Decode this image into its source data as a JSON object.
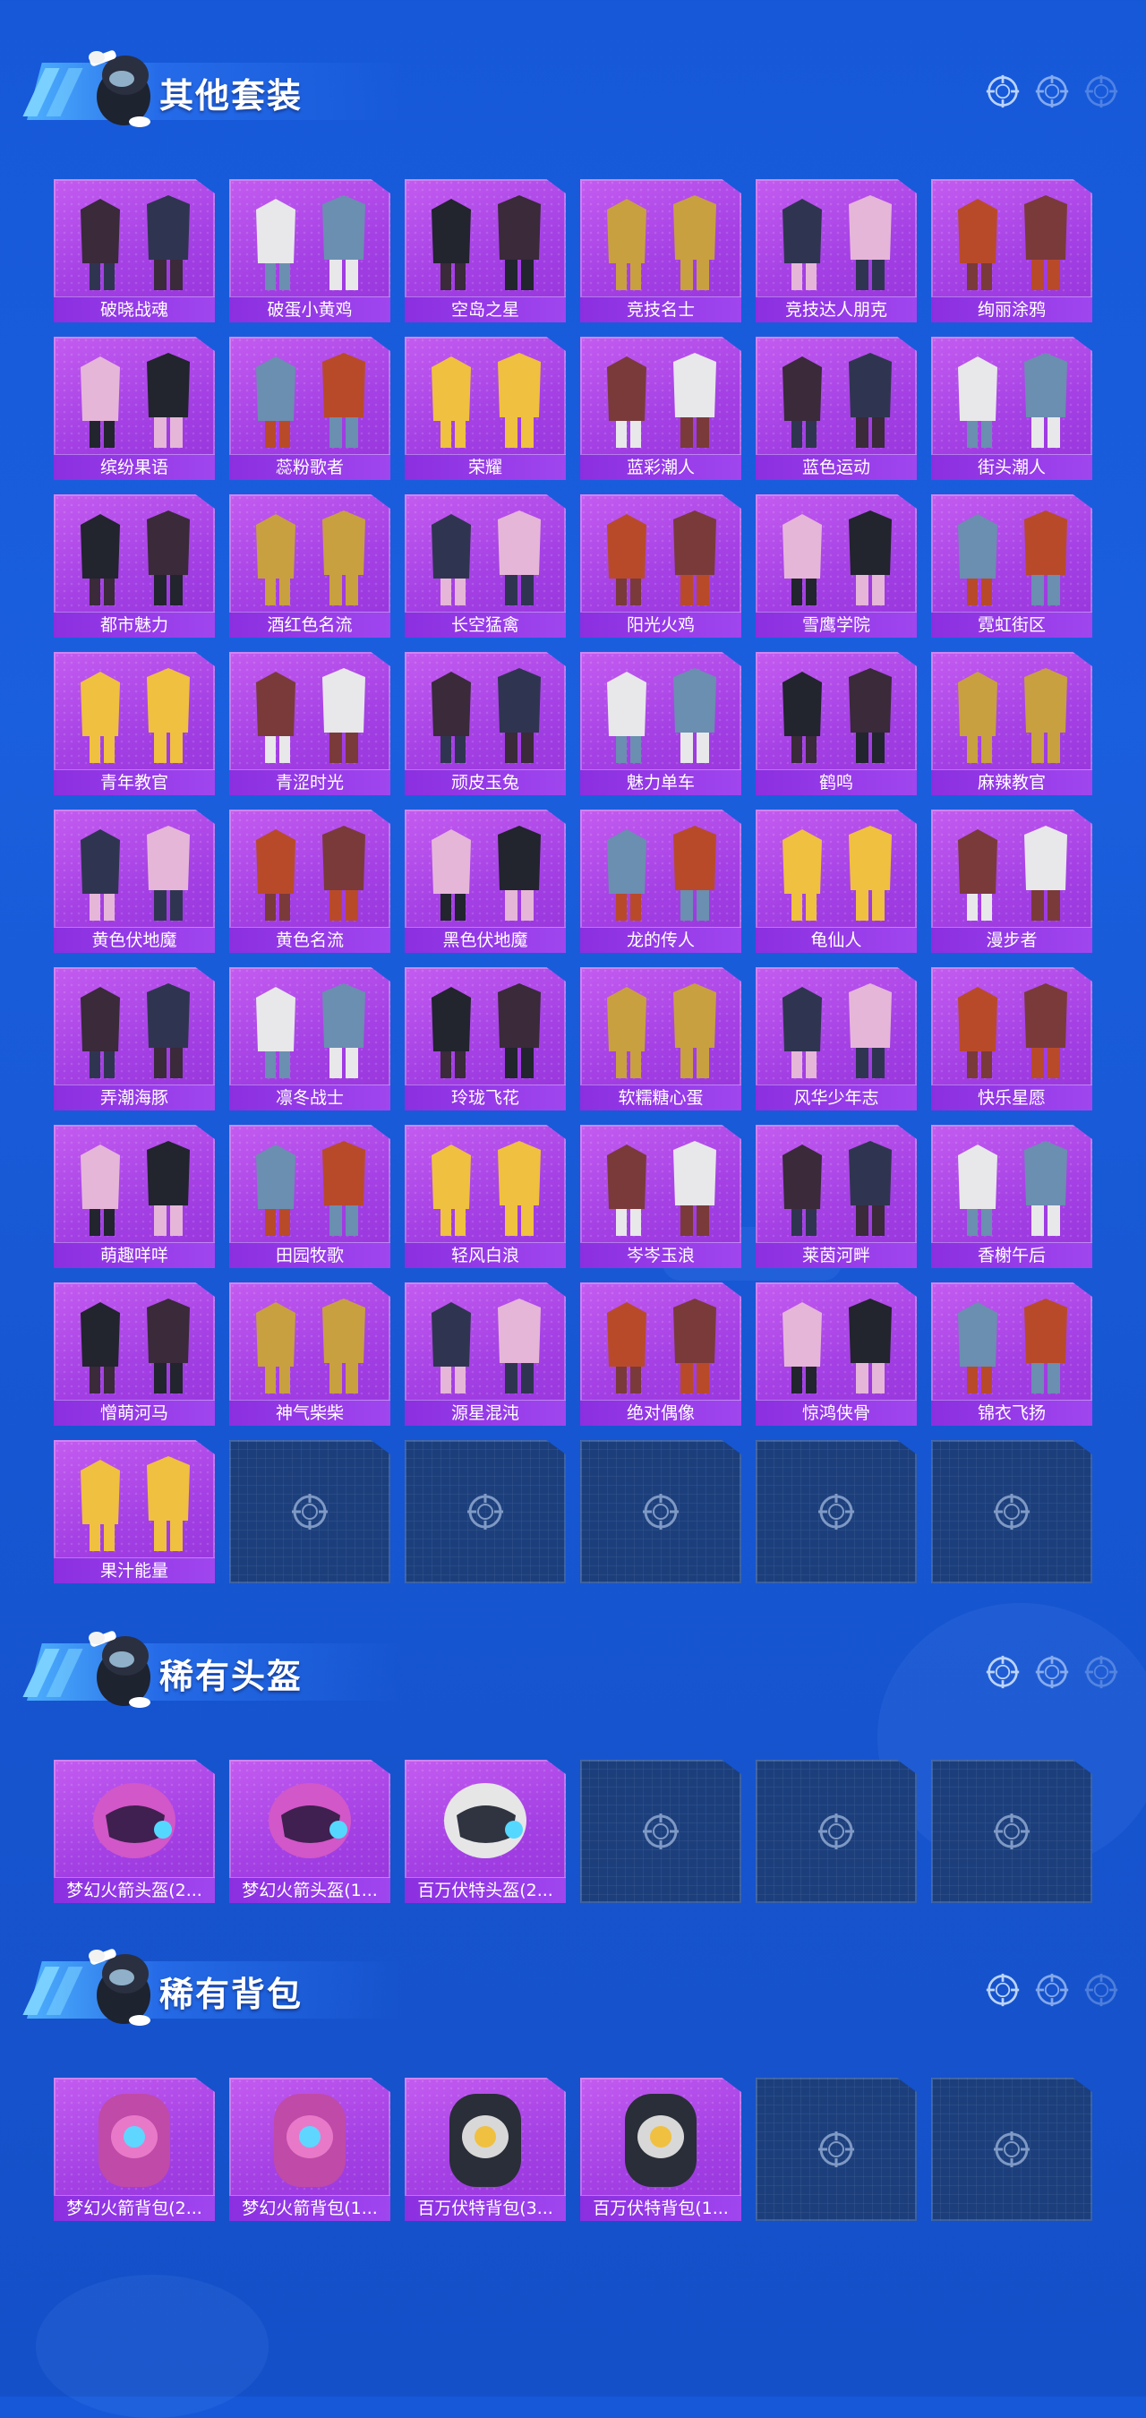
{
  "colors": {
    "background": "#1a5fde",
    "card_purple": "#a440e4",
    "label_purple": "#8b2fe0",
    "empty_slot": "#1c3f7c",
    "title_text": "#ffffff"
  },
  "sections": [
    {
      "title": "其他套装",
      "items": [
        {
          "name": "破晓战魂",
          "icon": "outfit-icon"
        },
        {
          "name": "破蛋小黄鸡",
          "icon": "outfit-icon"
        },
        {
          "name": "空岛之星",
          "icon": "outfit-icon"
        },
        {
          "name": "竞技名士",
          "icon": "outfit-icon"
        },
        {
          "name": "竞技达人朋克",
          "icon": "outfit-icon"
        },
        {
          "name": "绚丽涂鸦",
          "icon": "outfit-icon"
        },
        {
          "name": "缤纷果语",
          "icon": "outfit-icon"
        },
        {
          "name": "蕊粉歌者",
          "icon": "outfit-icon"
        },
        {
          "name": "荣耀",
          "icon": "outfit-icon"
        },
        {
          "name": "蓝彩潮人",
          "icon": "outfit-icon"
        },
        {
          "name": "蓝色运动",
          "icon": "outfit-icon"
        },
        {
          "name": "街头潮人",
          "icon": "outfit-icon"
        },
        {
          "name": "都市魅力",
          "icon": "outfit-icon"
        },
        {
          "name": "酒红色名流",
          "icon": "outfit-icon"
        },
        {
          "name": "长空猛禽",
          "icon": "outfit-icon"
        },
        {
          "name": "阳光火鸡",
          "icon": "outfit-icon"
        },
        {
          "name": "雪鹰学院",
          "icon": "outfit-icon"
        },
        {
          "name": "霓虹街区",
          "icon": "outfit-icon"
        },
        {
          "name": "青年教官",
          "icon": "outfit-icon"
        },
        {
          "name": "青涩时光",
          "icon": "outfit-icon"
        },
        {
          "name": "顽皮玉兔",
          "icon": "outfit-icon"
        },
        {
          "name": "魅力单车",
          "icon": "outfit-icon"
        },
        {
          "name": "鹤鸣",
          "icon": "outfit-icon"
        },
        {
          "name": "麻辣教官",
          "icon": "outfit-icon"
        },
        {
          "name": "黄色伏地魔",
          "icon": "outfit-icon"
        },
        {
          "name": "黄色名流",
          "icon": "outfit-icon"
        },
        {
          "name": "黑色伏地魔",
          "icon": "outfit-icon"
        },
        {
          "name": "龙的传人",
          "icon": "outfit-icon"
        },
        {
          "name": "龟仙人",
          "icon": "outfit-icon"
        },
        {
          "name": "漫步者",
          "icon": "outfit-icon"
        },
        {
          "name": "弄潮海豚",
          "icon": "outfit-icon"
        },
        {
          "name": "凛冬战士",
          "icon": "outfit-icon"
        },
        {
          "name": "玲珑飞花",
          "icon": "outfit-icon"
        },
        {
          "name": "软糯糖心蛋",
          "icon": "outfit-icon"
        },
        {
          "name": "风华少年志",
          "icon": "outfit-icon"
        },
        {
          "name": "快乐星愿",
          "icon": "outfit-icon"
        },
        {
          "name": "萌趣咩咩",
          "icon": "outfit-icon"
        },
        {
          "name": "田园牧歌",
          "icon": "outfit-icon"
        },
        {
          "name": "轻风白浪",
          "icon": "outfit-icon"
        },
        {
          "name": "岑岑玉浪",
          "icon": "outfit-icon"
        },
        {
          "name": "莱茵河畔",
          "icon": "outfit-icon"
        },
        {
          "name": "香榭午后",
          "icon": "outfit-icon"
        },
        {
          "name": "憎萌河马",
          "icon": "outfit-icon"
        },
        {
          "name": "神气柴柴",
          "icon": "outfit-icon"
        },
        {
          "name": "源星混沌",
          "icon": "outfit-icon"
        },
        {
          "name": "绝对偶像",
          "icon": "outfit-icon"
        },
        {
          "name": "惊鸿侠骨",
          "icon": "outfit-icon"
        },
        {
          "name": "锦衣飞扬",
          "icon": "outfit-icon"
        },
        {
          "name": "果汁能量",
          "icon": "outfit-icon"
        }
      ],
      "empty_slots": 5
    },
    {
      "title": "稀有头盔",
      "items": [
        {
          "name": "梦幻火箭头盔(2...",
          "icon": "helmet-icon"
        },
        {
          "name": "梦幻火箭头盔(1...",
          "icon": "helmet-icon"
        },
        {
          "name": "百万伏特头盔(2...",
          "icon": "helmet-icon"
        }
      ],
      "empty_slots": 3
    },
    {
      "title": "稀有背包",
      "items": [
        {
          "name": "梦幻火箭背包(2...",
          "icon": "backpack-icon"
        },
        {
          "name": "梦幻火箭背包(1...",
          "icon": "backpack-icon"
        },
        {
          "name": "百万伏特背包(3...",
          "icon": "backpack-icon"
        },
        {
          "name": "百万伏特背包(1...",
          "icon": "backpack-icon"
        }
      ],
      "empty_slots": 2
    }
  ]
}
